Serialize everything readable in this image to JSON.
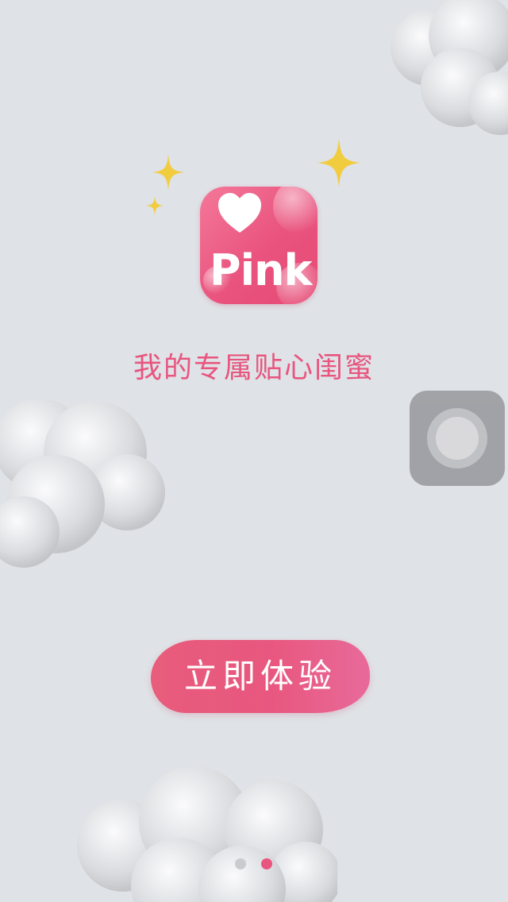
{
  "app": {
    "name": "Pink",
    "tagline": "我的专属贴心闺蜜"
  },
  "cta": {
    "label": "立即体验"
  },
  "pager": {
    "count": 2,
    "active_index": 1
  },
  "icons": {
    "app_logo": "heart-icon",
    "assistive_touch": "assistive-touch-icon",
    "decor": "sparkle-icon"
  },
  "colors": {
    "accent": "#e8557f",
    "background": "#dfe2e6",
    "sparkle": "#f2cc3f",
    "assistive_touch": "#9c9da2"
  }
}
